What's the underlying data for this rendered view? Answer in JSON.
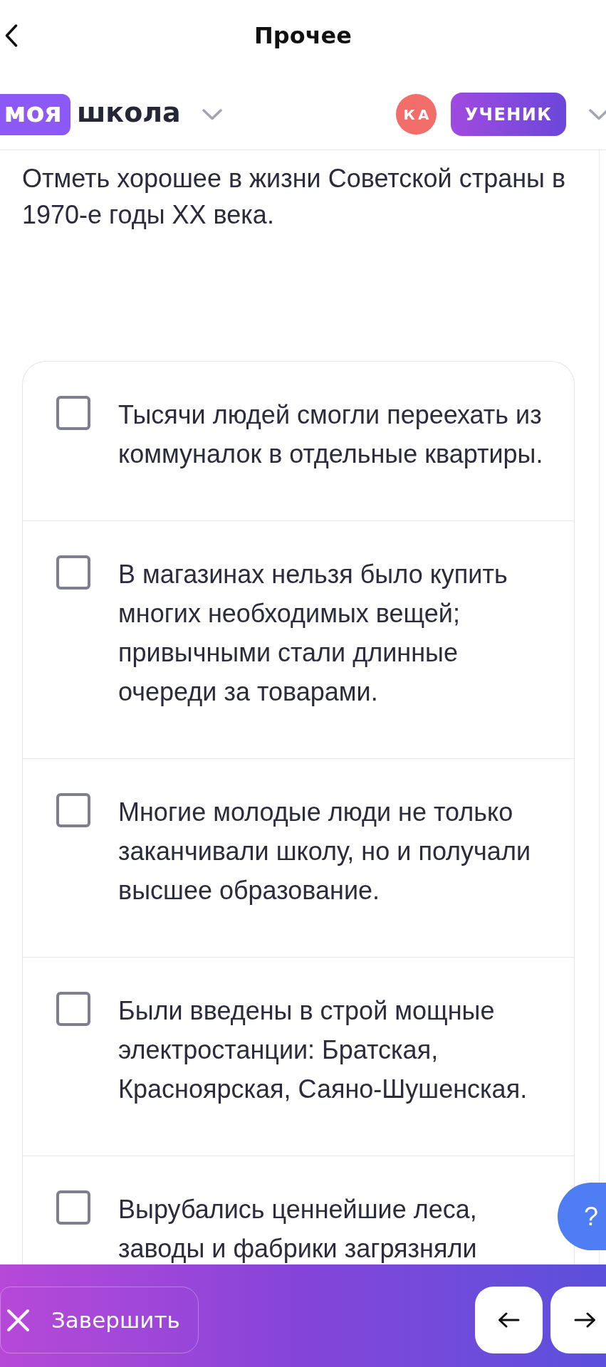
{
  "header": {
    "title": "Прочее"
  },
  "brand": {
    "badge": "моя",
    "name": "школа"
  },
  "user": {
    "initials": "КА",
    "role": "УЧЕНИК"
  },
  "question": {
    "text": "Отметь хорошее в жизни Советской страны в 1970-е годы XX века."
  },
  "options": [
    {
      "text": "Тысячи людей смогли переехать из коммуналок в отдельные квартиры.",
      "checked": false
    },
    {
      "text": "В магазинах нельзя было купить многих необходимых вещей; привычными стали длинные очереди за товарами.",
      "checked": false
    },
    {
      "text": "Многие молодые люди не только заканчивали школу, но и получали высшее образование.",
      "checked": false
    },
    {
      "text": "Были введены в строй мощные электростанции: Братская, Красноярская, Саяно-Шушенская.",
      "checked": false
    },
    {
      "text": "Вырубались ценнейшие леса, заводы и фабрики загрязняли",
      "checked": false
    }
  ],
  "help_button": {
    "label": "?"
  },
  "footer": {
    "finish": "Завершить"
  }
}
